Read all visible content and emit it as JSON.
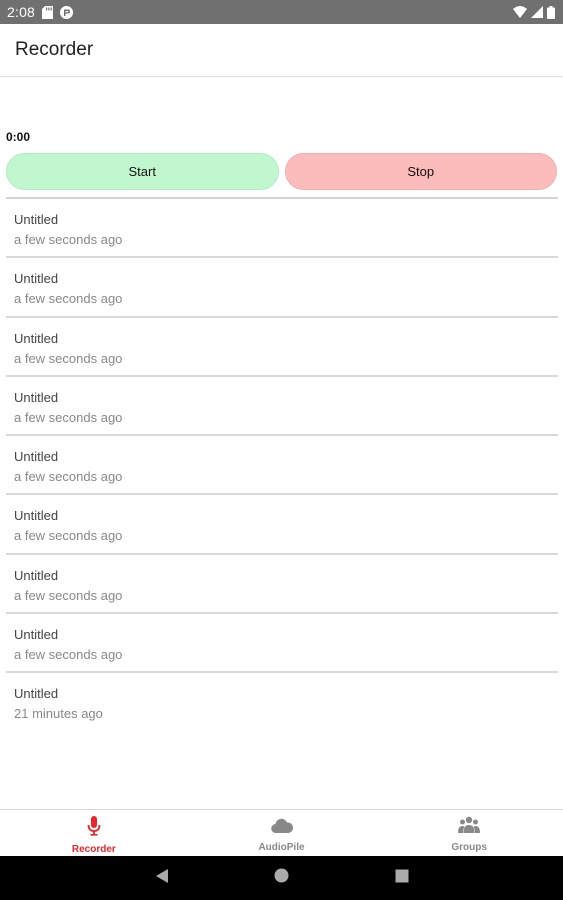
{
  "status_bar": {
    "time": "2:08"
  },
  "app_bar": {
    "title": "Recorder"
  },
  "timer": {
    "value": "0:00"
  },
  "controls": {
    "start_label": "Start",
    "stop_label": "Stop",
    "start_color": "#c0f7cf",
    "stop_color": "#fdbcbc"
  },
  "recordings": [
    {
      "name": "Untitled",
      "time": "a few seconds ago"
    },
    {
      "name": "Untitled",
      "time": "a few seconds ago"
    },
    {
      "name": "Untitled",
      "time": "a few seconds ago"
    },
    {
      "name": "Untitled",
      "time": "a few seconds ago"
    },
    {
      "name": "Untitled",
      "time": "a few seconds ago"
    },
    {
      "name": "Untitled",
      "time": "a few seconds ago"
    },
    {
      "name": "Untitled",
      "time": "a few seconds ago"
    },
    {
      "name": "Untitled",
      "time": "a few seconds ago"
    },
    {
      "name": "Untitled",
      "time": "21 minutes ago"
    }
  ],
  "tabs": [
    {
      "label": "Recorder",
      "icon": "microphone-icon",
      "active": true
    },
    {
      "label": "AudioPile",
      "icon": "cloud-icon",
      "active": false
    },
    {
      "label": "Groups",
      "icon": "groups-icon",
      "active": false
    }
  ],
  "colors": {
    "accent": "#e8262b",
    "inactive_tab": "#888888",
    "status_bar": "#707070"
  }
}
